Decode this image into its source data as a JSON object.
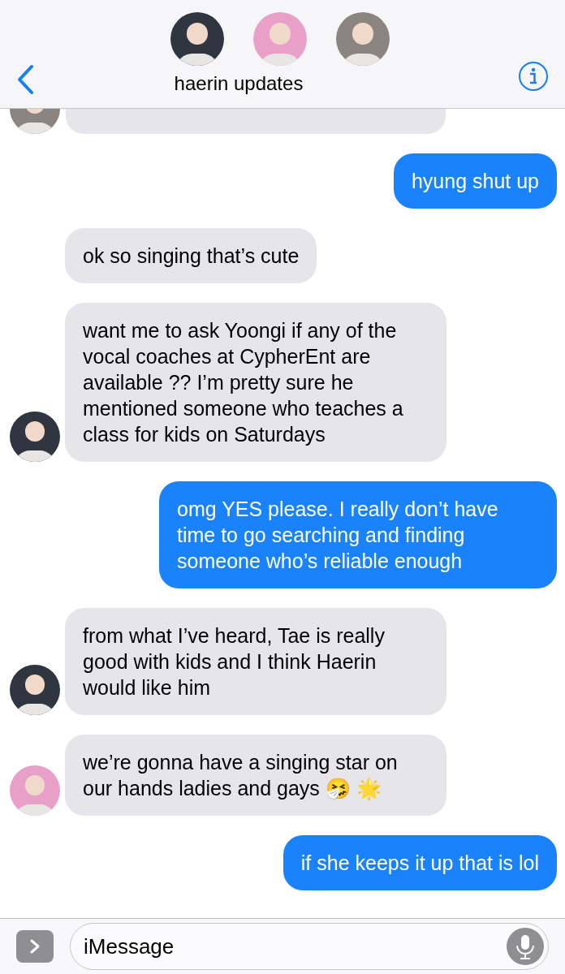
{
  "header": {
    "title": "haerin updates",
    "avatars": [
      {
        "color": "#2f3640"
      },
      {
        "color": "#e9a0c8"
      },
      {
        "color": "#8a8580"
      }
    ]
  },
  "messages": [
    {
      "kind": "partial",
      "avatar": {
        "color": "#8a8580"
      }
    },
    {
      "kind": "sent",
      "text": "hyung shut up"
    },
    {
      "kind": "received",
      "text": "ok so singing that’s cute"
    },
    {
      "kind": "received",
      "text": "want me to ask Yoongi if any of the vocal coaches at CypherEnt are available ?? I’m pretty sure he mentioned someone who teaches a class for kids on Saturdays",
      "avatar": {
        "color": "#2f3640"
      }
    },
    {
      "kind": "sent",
      "text": "omg YES please. I really don’t have time to go searching and finding someone who’s reliable enough"
    },
    {
      "kind": "received",
      "text": "from what I’ve heard, Tae is really good with kids and I think Haerin would like him",
      "avatar": {
        "color": "#2f3640"
      }
    },
    {
      "kind": "received",
      "text": "we’re gonna have a singing star on our hands ladies and gays 🤧 🌟",
      "avatar": {
        "color": "#e9a0c8"
      }
    },
    {
      "kind": "sent",
      "text": "if she keeps it up that is lol"
    }
  ],
  "input": {
    "placeholder": "iMessage"
  }
}
